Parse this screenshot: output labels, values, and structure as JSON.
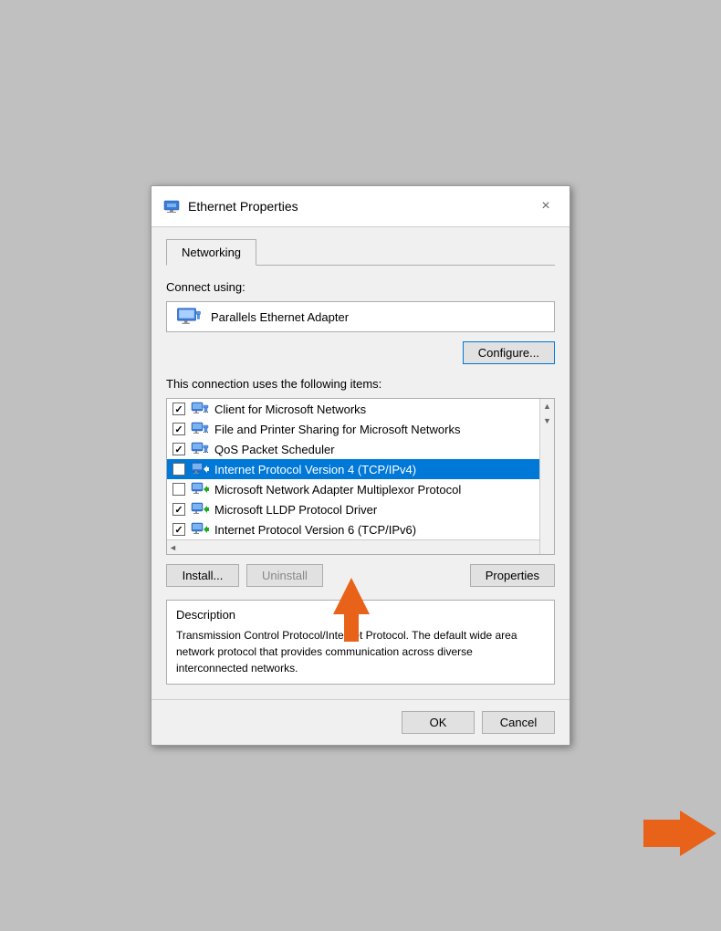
{
  "dialog": {
    "title": "Ethernet Properties",
    "close_label": "×"
  },
  "tabs": [
    {
      "label": "Networking",
      "active": true
    }
  ],
  "connect_using_label": "Connect using:",
  "adapter": {
    "name": "Parallels Ethernet Adapter"
  },
  "configure_button": "Configure...",
  "connection_items_label": "This connection uses the following items:",
  "items": [
    {
      "checked": true,
      "icon": "network",
      "label": "Client for Microsoft Networks",
      "selected": false
    },
    {
      "checked": true,
      "icon": "network",
      "label": "File and Printer Sharing for Microsoft Networks",
      "selected": false
    },
    {
      "checked": true,
      "icon": "network",
      "label": "QoS Packet Scheduler",
      "selected": false
    },
    {
      "checked": true,
      "icon": "green-arrow",
      "label": "Internet Protocol Version 4 (TCP/IPv4)",
      "selected": true
    },
    {
      "checked": false,
      "icon": "green-arrow",
      "label": "Microsoft Network Adapter Multiplexor Protocol",
      "selected": false
    },
    {
      "checked": true,
      "icon": "green-arrow",
      "label": "Microsoft LLDP Protocol Driver",
      "selected": false
    },
    {
      "checked": true,
      "icon": "green-arrow",
      "label": "Internet Protocol Version 6 (TCP/IPv6)",
      "selected": false
    }
  ],
  "action_buttons": {
    "install": "Install...",
    "uninstall": "Uninstall",
    "properties": "Properties"
  },
  "description": {
    "title": "Description",
    "text": "Transmission Control Protocol/Internet Protocol. The default wide area network protocol that provides communication across diverse interconnected networks."
  },
  "footer": {
    "ok": "OK",
    "cancel": "Cancel"
  }
}
